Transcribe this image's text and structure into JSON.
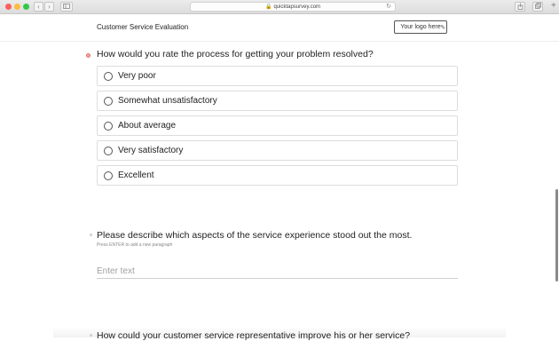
{
  "browser": {
    "url": "quicktapsurvey.com",
    "back": "‹",
    "forward": "›"
  },
  "survey": {
    "title": "Customer Service Evaluation",
    "logo_placeholder": "Your logo here"
  },
  "questions": [
    {
      "text": "How would you rate the process for getting your problem resolved?",
      "options": [
        "Very poor",
        "Somewhat unsatisfactory",
        "About average",
        "Very satisfactory",
        "Excellent"
      ]
    },
    {
      "text": "Please describe which aspects of the service experience stood out the most.",
      "hint": "Press ENTER to add a new paragraph",
      "placeholder": "Enter text"
    },
    {
      "text": "How could your customer service representative improve his or her service?"
    }
  ]
}
